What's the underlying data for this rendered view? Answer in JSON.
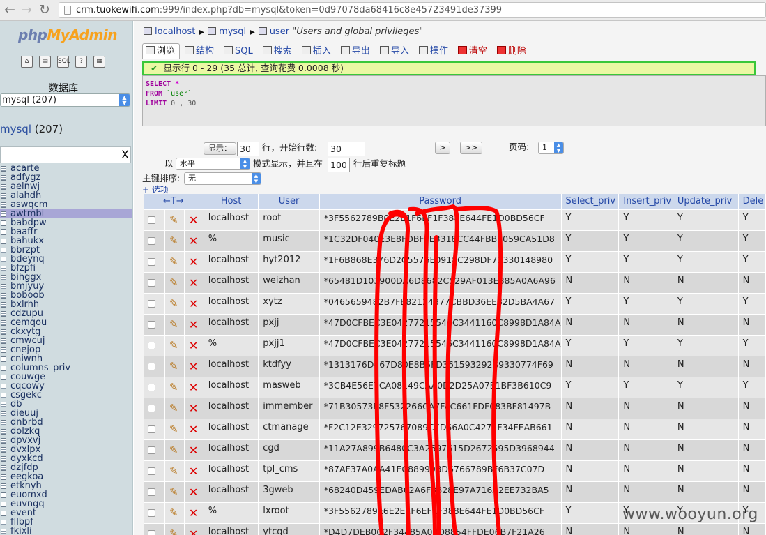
{
  "browser": {
    "url_host": "crm.tuokewifi.com",
    "url_rest": ":999/index.php?db=mysql&token=0d97078da68416c8e45723491de37399"
  },
  "sidebar": {
    "logo_part1": "php",
    "logo_part2": "MyAdmin",
    "icons": [
      "home-icon",
      "query-window-icon",
      "sql-icon",
      "docs-icon",
      "help-icon"
    ],
    "icon_glyphs": [
      "⌂",
      "▤",
      "SQL",
      "?",
      "▦"
    ],
    "db_label": "数据库",
    "db_select_value": "mysql (207)",
    "db_name": "mysql",
    "db_count": "(207)",
    "filter_clear": "X",
    "active_table": "awtmbi",
    "tables": [
      "acarte",
      "adfygz",
      "aelnwj",
      "alahdh",
      "aswqcm",
      "awtmbi",
      "babdpw",
      "baaffr",
      "bahukx",
      "bbrzpt",
      "bdeynq",
      "bfzpfi",
      "bihggx",
      "bmjyuy",
      "boboob",
      "bxlrhh",
      "cdzupu",
      "cemqou",
      "ckxytg",
      "cmwcuj",
      "cnejop",
      "cniwnh",
      "columns_priv",
      "couwge",
      "cqcowy",
      "csgekc",
      "db",
      "dieuuj",
      "dnbrbd",
      "dolzkq",
      "dpvxvj",
      "dvxlpx",
      "dyxkcd",
      "dzjfdp",
      "eegkoa",
      "etknyh",
      "euomxd",
      "euvngq",
      "event",
      "fllbpf",
      "fkixli"
    ]
  },
  "breadcrumb": {
    "server": "localhost",
    "database": "mysql",
    "table": "user",
    "comment": "\"Users and global privileges\""
  },
  "tabs": [
    {
      "label": "浏览",
      "icon": "browse-icon",
      "active": true
    },
    {
      "label": "结构",
      "icon": "structure-icon"
    },
    {
      "label": "SQL",
      "icon": "sql-icon"
    },
    {
      "label": "搜索",
      "icon": "search-icon"
    },
    {
      "label": "插入",
      "icon": "insert-icon"
    },
    {
      "label": "导出",
      "icon": "export-icon"
    },
    {
      "label": "导入",
      "icon": "import-icon"
    },
    {
      "label": "操作",
      "icon": "operations-icon"
    },
    {
      "label": "清空",
      "icon": "empty-icon",
      "danger": true
    },
    {
      "label": "删除",
      "icon": "drop-icon",
      "danger": true
    }
  ],
  "message": "显示行 0 - 29 (35 总计, 查询花费 0.0008 秒)",
  "sql": {
    "select_kw": "SELECT",
    "star": "*",
    "from_kw": "FROM",
    "table": "`user`",
    "limit_kw": "LIMIT",
    "limit_a": "0",
    "comma": ",",
    "limit_b": "30"
  },
  "controls": {
    "show_button": "显示：",
    "rows_value": "30",
    "rows_label": "行，开始行数:",
    "start_value": "30",
    "next_button": ">",
    "last_button": ">>",
    "page_label": "页码:",
    "page_value": "1",
    "mode_prefix": "以",
    "mode_value": "水平",
    "mode_suffix": "模式显示，并且在",
    "repeat_value": "100",
    "repeat_suffix": "行后重复标题",
    "sort_label": "主键排序:",
    "sort_value": "无",
    "options_link": "+ 选项"
  },
  "table": {
    "arrows_header": "←T→",
    "columns": [
      "Host",
      "User",
      "Password",
      "Select_priv",
      "Insert_priv",
      "Update_priv",
      "Dele"
    ],
    "rows": [
      [
        "localhost",
        "root",
        "*3F5562789B0E2E1F6EF1F388E644FE1D0BD56CF",
        "Y",
        "Y",
        "Y",
        "Y"
      ],
      [
        "%",
        "music",
        "*1C32DF040E3E8FDBFFE3318CC44FBB0059CA51D8",
        "Y",
        "Y",
        "Y",
        "Y"
      ],
      [
        "localhost",
        "hyt2012",
        "*1F6B868E376D2C5576E0918C298DF71330148980",
        "Y",
        "Y",
        "Y",
        "Y"
      ],
      [
        "localhost",
        "weizhan",
        "*65481D103900DA6D8682C529AF013E885A0A6A96",
        "N",
        "N",
        "N",
        "N"
      ],
      [
        "localhost",
        "xytz",
        "*0465659482B7FE82124877CBBD36EE82D5BA4A67",
        "Y",
        "Y",
        "Y",
        "Y"
      ],
      [
        "localhost",
        "pxjj",
        "*47D0CFBEC3E04277215546C3441160C8998D1A84A",
        "N",
        "N",
        "N",
        "N"
      ],
      [
        "%",
        "pxjj1",
        "*47D0CFBEC3E04277215546C3441160C8998D1A84A",
        "Y",
        "Y",
        "Y",
        "Y"
      ],
      [
        "localhost",
        "ktdfyy",
        "*1313176D467D80E8B5FD361593292B9330774F69",
        "N",
        "N",
        "N",
        "N"
      ],
      [
        "localhost",
        "masweb",
        "*3CB4E56E7CA08149CAA0D2D25A07E1BF3B610C9",
        "Y",
        "Y",
        "Y",
        "Y"
      ],
      [
        "localhost",
        "immember",
        "*71B30573E8F532266CA7FAC661FDF083BF81497B",
        "N",
        "N",
        "N",
        "N"
      ],
      [
        "localhost",
        "ctmanage",
        "*F2C12E329725767089C7D56A0C4271F34FEAB661",
        "N",
        "N",
        "N",
        "N"
      ],
      [
        "localhost",
        "cgd",
        "*11A27A899B6480C3A2697615D2672595D3968944",
        "N",
        "N",
        "N",
        "N"
      ],
      [
        "localhost",
        "tpl_cms",
        "*87AF37A0AA41EC88999BD6766789BF6B37C07D",
        "N",
        "N",
        "N",
        "N"
      ],
      [
        "localhost",
        "3gweb",
        "*68240D459EDAB62A6F3828E97A716A2EE732BA5",
        "N",
        "N",
        "N",
        "N"
      ],
      [
        "%",
        "lxroot",
        "*3F5562789E6E2E1F6EF1F388E644FE1D0BD56CF",
        "Y",
        "Y",
        "Y",
        "Y"
      ],
      [
        "localhost",
        "ytcgd",
        "*D4D7DEB0C2F34485A00D8854FFDE06B7F21A26",
        "N",
        "N",
        "N",
        "N"
      ]
    ]
  },
  "watermark": "www.wooyun.org",
  "colors": {
    "sidebar_bg": "#d0dce0",
    "header_bg": "#ccd8ec",
    "link": "#2347a6",
    "message_border": "#3ac73a",
    "scribble": "#ff0000"
  }
}
